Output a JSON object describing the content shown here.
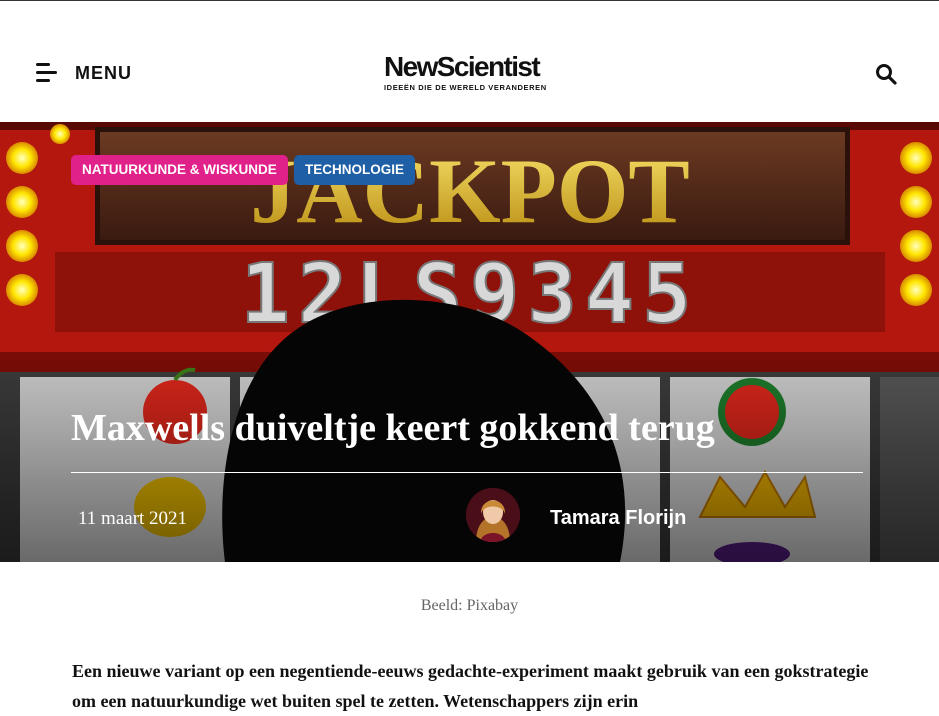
{
  "header": {
    "menu_label": "MENU",
    "logo_text": "NewScientist",
    "logo_tagline": "IDEEËN DIE DE WERELD VERANDEREN",
    "icons": {
      "menu": "hamburger-menu-icon",
      "search": "search-icon"
    }
  },
  "article": {
    "tags": [
      {
        "label": "NATUURKUNDE & WISKUNDE",
        "color": "#e0218a"
      },
      {
        "label": "TECHNOLOGIE",
        "color": "#1f5fa5"
      }
    ],
    "title": "Maxwells duiveltje keert gokkend terug",
    "date": "11 maart 2021",
    "author": "Tamara Florijn",
    "image_caption": "Beeld: Pixabay",
    "intro": "Een nieuwe variant op een negentiende-eeuws gedachte-experiment maakt gebruik van een gokstrategie om een natuurkundige wet buiten spel te zetten. Wetenschappers zijn erin"
  },
  "hero_image": {
    "sign_text": "JACKPOT",
    "counter_digits": "12LS9345"
  }
}
